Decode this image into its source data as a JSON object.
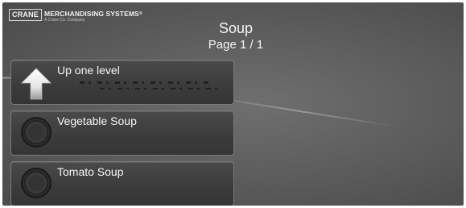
{
  "brand": {
    "box_text": "CRANE",
    "name": "MERCHANDISING SYSTEMS",
    "trademark": "®",
    "tagline": "A Crane Co. Company"
  },
  "header": {
    "title": "Soup",
    "page_indicator": "Page 1 / 1"
  },
  "menu": {
    "items": [
      {
        "label": "Up one level",
        "icon": "up-arrow-icon"
      },
      {
        "label": "Vegetable Soup",
        "icon": "soup-bowl-icon"
      },
      {
        "label": "Tomato Soup",
        "icon": "soup-bowl-icon"
      }
    ]
  },
  "colors": {
    "background": "#5b5b5b",
    "button_fill": "#3f3f3f",
    "button_border": "#7a7a7a",
    "text": "#f4f4f4"
  }
}
